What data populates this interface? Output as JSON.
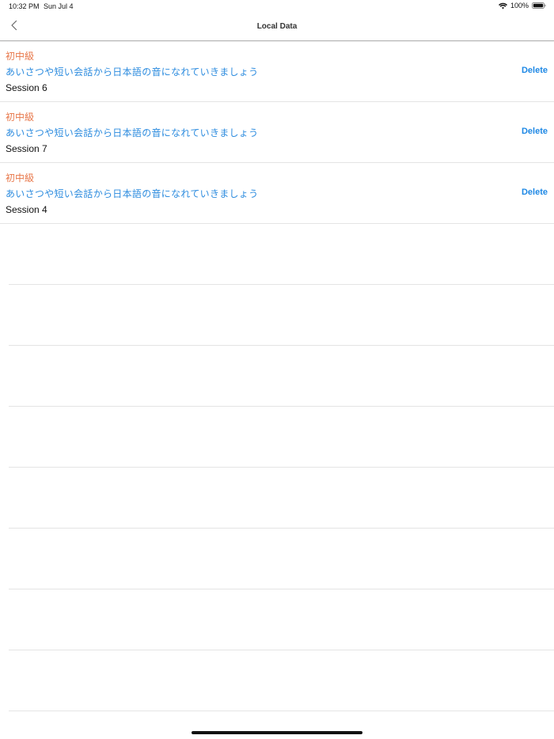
{
  "status_bar": {
    "time": "10:32 PM",
    "date": "Sun Jul 4",
    "battery": "100%"
  },
  "nav": {
    "title": "Local Data",
    "back_icon": "chevron-left-icon"
  },
  "items": [
    {
      "level": "初中級",
      "description": "あいさつや短い会話から日本語の音になれていきましょう",
      "session": "Session 6",
      "delete_label": "Delete"
    },
    {
      "level": "初中級",
      "description": "あいさつや短い会話から日本語の音になれていきましょう",
      "session": "Session 7",
      "delete_label": "Delete"
    },
    {
      "level": "初中級",
      "description": "あいさつや短い会話から日本語の音になれていきましょう",
      "session": "Session 4",
      "delete_label": "Delete"
    }
  ],
  "colors": {
    "level": "#e8774a",
    "description": "#2d8cdf",
    "delete": "#1e88e5"
  }
}
